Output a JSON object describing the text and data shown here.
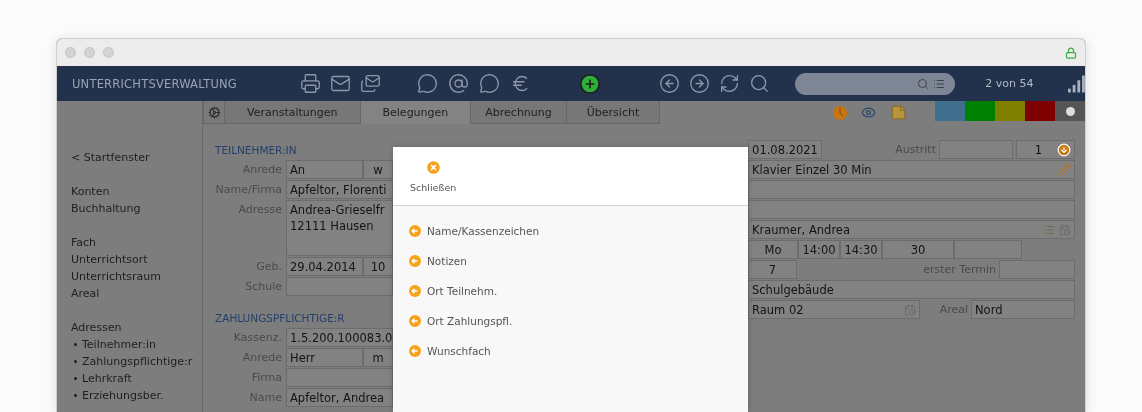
{
  "app": {
    "title": "UNTERRICHTSVERWALTUNG",
    "record_counter": "2 von 54"
  },
  "tabs": [
    {
      "label": "Veranstaltungen",
      "selected": false
    },
    {
      "label": "Belegungen",
      "selected": true
    },
    {
      "label": "Abrechnung",
      "selected": false
    },
    {
      "label": "Übersicht",
      "selected": false
    }
  ],
  "color_filters": [
    {
      "color": "#3f6f8c",
      "selected": false
    },
    {
      "color": "#008000",
      "selected": false
    },
    {
      "color": "#7f7f00",
      "selected": false
    },
    {
      "color": "#7f0000",
      "selected": false
    },
    {
      "color": "#555555",
      "selected": true
    }
  ],
  "sidebar": {
    "back_link": "< Startfenster",
    "groups": [
      {
        "items": [
          {
            "label": "Konten",
            "kind": "link"
          },
          {
            "label": "Buchhaltung",
            "kind": "link"
          }
        ]
      },
      {
        "items": [
          {
            "label": "Fach",
            "kind": "link"
          },
          {
            "label": "Unterrichtsort",
            "kind": "link"
          },
          {
            "label": "Unterrichtsraum",
            "kind": "link"
          },
          {
            "label": "Areal",
            "kind": "link"
          }
        ]
      },
      {
        "items": [
          {
            "label": "Adressen",
            "kind": "heading"
          },
          {
            "label": "Teilnehmer:in",
            "kind": "bullet"
          },
          {
            "label": "Zahlungspflichtige:r",
            "kind": "bullet"
          },
          {
            "label": "Lehrkraft",
            "kind": "bullet"
          },
          {
            "label": "Erziehungsber.",
            "kind": "bullet"
          }
        ]
      }
    ]
  },
  "participant": {
    "heading": "TEILNEHMER:IN",
    "rows": [
      {
        "label": "Anrede",
        "kind": "text",
        "values": [
          "An",
          "w"
        ]
      },
      {
        "label": "Name/Firma",
        "kind": "text",
        "values": [
          "Apfeltor, Florenti"
        ]
      },
      {
        "label": "Adresse",
        "kind": "multiline",
        "lines": [
          "Andrea-Grieselfr",
          "12111 Hausen"
        ]
      },
      {
        "label": "Geb.",
        "kind": "text",
        "values": [
          "29.04.2014",
          "10"
        ]
      },
      {
        "label": "Schule",
        "kind": "blank"
      }
    ]
  },
  "payer": {
    "heading": "ZAHLUNGSPFLICHTIGE:R",
    "rows": [
      {
        "label": "Kassenz.",
        "kind": "text",
        "values": [
          "1.5.200.100083.0"
        ]
      },
      {
        "label": "Anrede",
        "kind": "text",
        "values": [
          "Herr",
          "m"
        ]
      },
      {
        "label": "Firma",
        "kind": "blank"
      },
      {
        "label": "Name",
        "kind": "text",
        "values": [
          "Apfeltor, Andrea"
        ]
      }
    ]
  },
  "booking": {
    "rows": [
      {
        "kind": "entry",
        "date": "01.08.2021",
        "exit_label": "Austritt",
        "quantity": "1"
      },
      {
        "kind": "course",
        "value": "Klavier Einzel 30 Min"
      },
      {
        "kind": "blank"
      },
      {
        "kind": "blank"
      },
      {
        "kind": "teacher",
        "value": "Kraumer, Andrea"
      },
      {
        "kind": "schedule",
        "cells": [
          "Mo",
          "14:00",
          "14:30",
          "30"
        ]
      },
      {
        "kind": "first_date",
        "value": "7",
        "label": "erster Termin"
      },
      {
        "kind": "text",
        "value": "Schulgebäude"
      },
      {
        "kind": "room",
        "value": "Raum 02",
        "label": "Areal",
        "area": "Nord"
      }
    ]
  },
  "modal": {
    "close_label": "Schließen",
    "items": [
      {
        "label": "Name/Kassenzeichen"
      },
      {
        "label": "Notizen"
      },
      {
        "label": "Ort Teilnehm."
      },
      {
        "label": "Ort Zahlungspfl."
      },
      {
        "label": "Wunschfach"
      }
    ]
  }
}
